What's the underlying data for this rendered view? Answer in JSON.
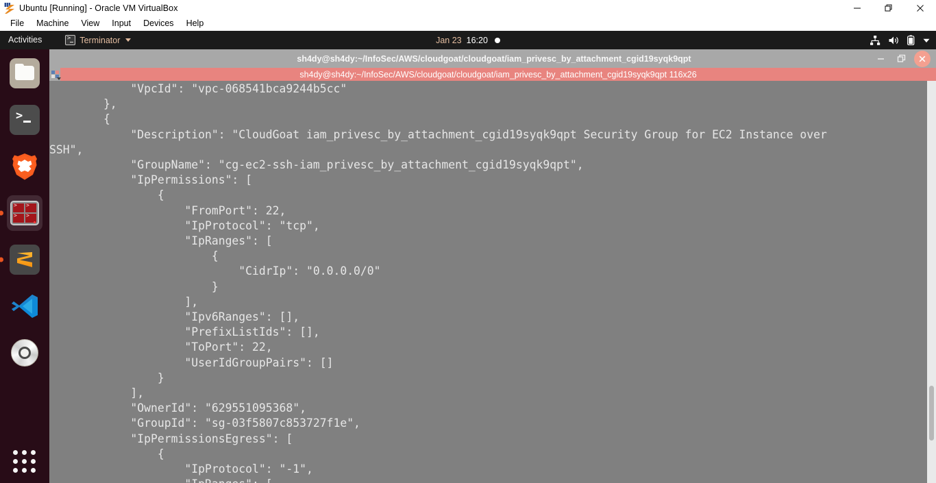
{
  "host_window": {
    "title": "Ubuntu [Running] - Oracle VM VirtualBox",
    "app_icon": "virtualbox-icon",
    "menu": [
      {
        "label": "File"
      },
      {
        "label": "Machine"
      },
      {
        "label": "View"
      },
      {
        "label": "Input"
      },
      {
        "label": "Devices"
      },
      {
        "label": "Help"
      }
    ],
    "controls": {
      "minimize": "minimize-icon",
      "maximize": "maximize-icon",
      "close": "close-icon"
    }
  },
  "gnome_topbar": {
    "activities": "Activities",
    "app_menu": {
      "icon": "terminal-icon",
      "label": "Terminator",
      "caret": "chevron-down-icon"
    },
    "clock": {
      "date": "Jan 23",
      "time": "16:20",
      "indicator": "notification-dot"
    },
    "tray": [
      {
        "name": "network-icon"
      },
      {
        "name": "volume-icon"
      },
      {
        "name": "battery-icon"
      },
      {
        "name": "system-menu-chevron-icon"
      }
    ]
  },
  "dock": {
    "items": [
      {
        "name": "files",
        "icon": "files-icon",
        "running": false,
        "active": false
      },
      {
        "name": "terminal",
        "icon": "terminal-icon",
        "running": false,
        "active": false
      },
      {
        "name": "brave",
        "icon": "brave-browser-icon",
        "running": false,
        "active": false
      },
      {
        "name": "terminator",
        "icon": "terminator-icon",
        "running": true,
        "active": true
      },
      {
        "name": "sublime-text",
        "icon": "sublime-text-icon",
        "running": true,
        "active": false
      },
      {
        "name": "vscode",
        "icon": "visual-studio-code-icon",
        "running": false,
        "active": false
      },
      {
        "name": "disc",
        "icon": "cd-drive-icon",
        "running": false,
        "active": false
      }
    ],
    "show_applications": "show-applications-grid"
  },
  "terminal_window": {
    "title": "sh4dy@sh4dy:~/InfoSec/AWS/cloudgoat/cloudgoat/iam_privesc_by_attachment_cgid19syqk9qpt",
    "tab_label": "sh4dy@sh4dy:~/InfoSec/AWS/cloudgoat/cloudgoat/iam_privesc_by_attachment_cgid19syqk9qpt 116x26",
    "controls": {
      "minimize": "minimize-icon",
      "maximize": "maximize-icon",
      "close": "close-icon"
    },
    "colors": {
      "background": "#808080",
      "foreground": "#e6e6e6",
      "titlebar": "#a8a8a8",
      "tab_active": "#e8847f",
      "close_button": "#f4a090",
      "accent_orange": "#e95420"
    },
    "content": "            \"VpcId\": \"vpc-068541bca9244b5cc\"\n        },\n        {\n            \"Description\": \"CloudGoat iam_privesc_by_attachment_cgid19syqk9qpt Security Group for EC2 Instance over\nSSH\",\n            \"GroupName\": \"cg-ec2-ssh-iam_privesc_by_attachment_cgid19syqk9qpt\",\n            \"IpPermissions\": [\n                {\n                    \"FromPort\": 22,\n                    \"IpProtocol\": \"tcp\",\n                    \"IpRanges\": [\n                        {\n                            \"CidrIp\": \"0.0.0.0/0\"\n                        }\n                    ],\n                    \"Ipv6Ranges\": [],\n                    \"PrefixListIds\": [],\n                    \"ToPort\": 22,\n                    \"UserIdGroupPairs\": []\n                }\n            ],\n            \"OwnerId\": \"629551095368\",\n            \"GroupId\": \"sg-03f5807c853727f1e\",\n            \"IpPermissionsEgress\": [\n                {\n                    \"IpProtocol\": \"-1\",\n                    \"IpRanges\": ["
  }
}
